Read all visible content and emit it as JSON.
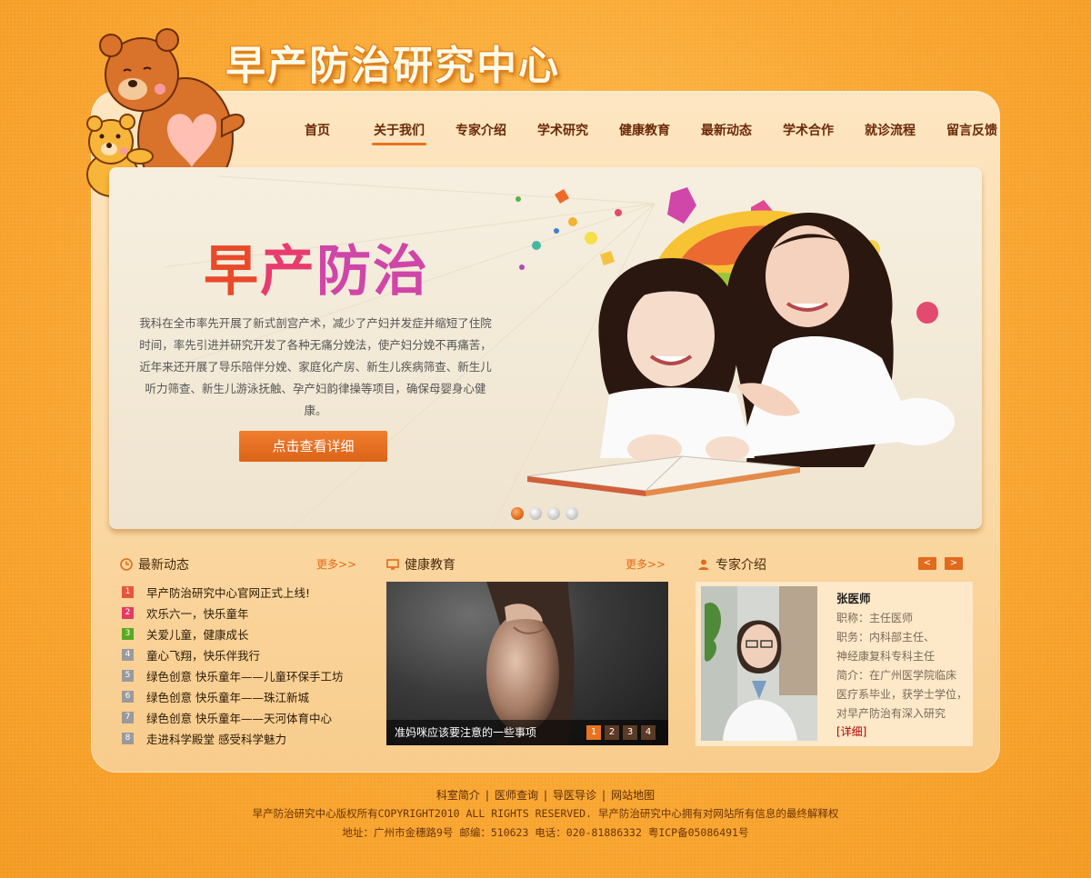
{
  "site": {
    "title": "早产防治研究中心"
  },
  "nav": {
    "items": [
      {
        "label": "首页"
      },
      {
        "label": "关于我们"
      },
      {
        "label": "专家介绍"
      },
      {
        "label": "学术研究"
      },
      {
        "label": "健康教育"
      },
      {
        "label": "最新动态"
      },
      {
        "label": "学术合作"
      },
      {
        "label": "就诊流程"
      },
      {
        "label": "留言反馈"
      }
    ],
    "active_index": 1
  },
  "banner": {
    "headline_parts": [
      "早",
      "产",
      "防治"
    ],
    "description": "我科在全市率先开展了新式剖宫产术，减少了产妇并发症并缩短了住院时间，率先引进并研究开发了各种无痛分娩法，使产妇分娩不再痛苦，近年来还开展了导乐陪伴分娩、家庭化产房、新生儿疾病筛查、新生儿听力筛查、新生儿游泳抚触、孕产妇韵律操等项目，确保母婴身心健康。",
    "button_label": "点击查看详细",
    "slide_count": 4,
    "active_slide": 1
  },
  "news": {
    "title": "最新动态",
    "more": "更多>>",
    "items": [
      {
        "num": "1",
        "text": "早产防治研究中心官网正式上线!",
        "color": "#e8553d"
      },
      {
        "num": "2",
        "text": "欢乐六一，快乐童年",
        "color": "#e33b64"
      },
      {
        "num": "3",
        "text": "关爱儿童，健康成长",
        "color": "#5aa823"
      },
      {
        "num": "4",
        "text": "童心飞翔，快乐伴我行",
        "color": "#9a9a9a"
      },
      {
        "num": "5",
        "text": "绿色创意 快乐童年——儿童环保手工坊",
        "color": "#9a9a9a"
      },
      {
        "num": "6",
        "text": "绿色创意 快乐童年——珠江新城",
        "color": "#9a9a9a"
      },
      {
        "num": "7",
        "text": "绿色创意 快乐童年——天河体育中心",
        "color": "#9a9a9a"
      },
      {
        "num": "8",
        "text": "走进科学殿堂 感受科学魅力",
        "color": "#9a9a9a"
      }
    ]
  },
  "health": {
    "title": "健康教育",
    "more": "更多>>",
    "caption": "准妈咪应该要注意的一些事项",
    "pages": [
      "1",
      "2",
      "3",
      "4"
    ],
    "active_page": 0
  },
  "experts": {
    "title": "专家介绍",
    "prev": "<",
    "next": ">",
    "name": "张医师",
    "lines": [
      "职称：主任医师",
      "职务：内科部主任、",
      "神经康复科专科主任",
      "简介：在广州医学院临床",
      "医疗系毕业，获学士学位，",
      "对早产防治有深入研究"
    ],
    "detail_label": "[详细]"
  },
  "footer": {
    "links": [
      "科室简介",
      "医师查询",
      "导医导诊",
      "网站地图"
    ],
    "separator": "|",
    "copyright": "早产防治研究中心版权所有COPYRIGHT2010 ALL RIGHTS RESERVED. 早产防治研究中心拥有对网站所有信息的最终解释权",
    "address": "地址：广州市金穗路9号 邮编：510623 电话：020-81886332  粤ICP备05086491号"
  },
  "colors": {
    "accent": "#e8731e",
    "nav_text": "#6b2a08",
    "panel_bg": "#fde6c2"
  }
}
